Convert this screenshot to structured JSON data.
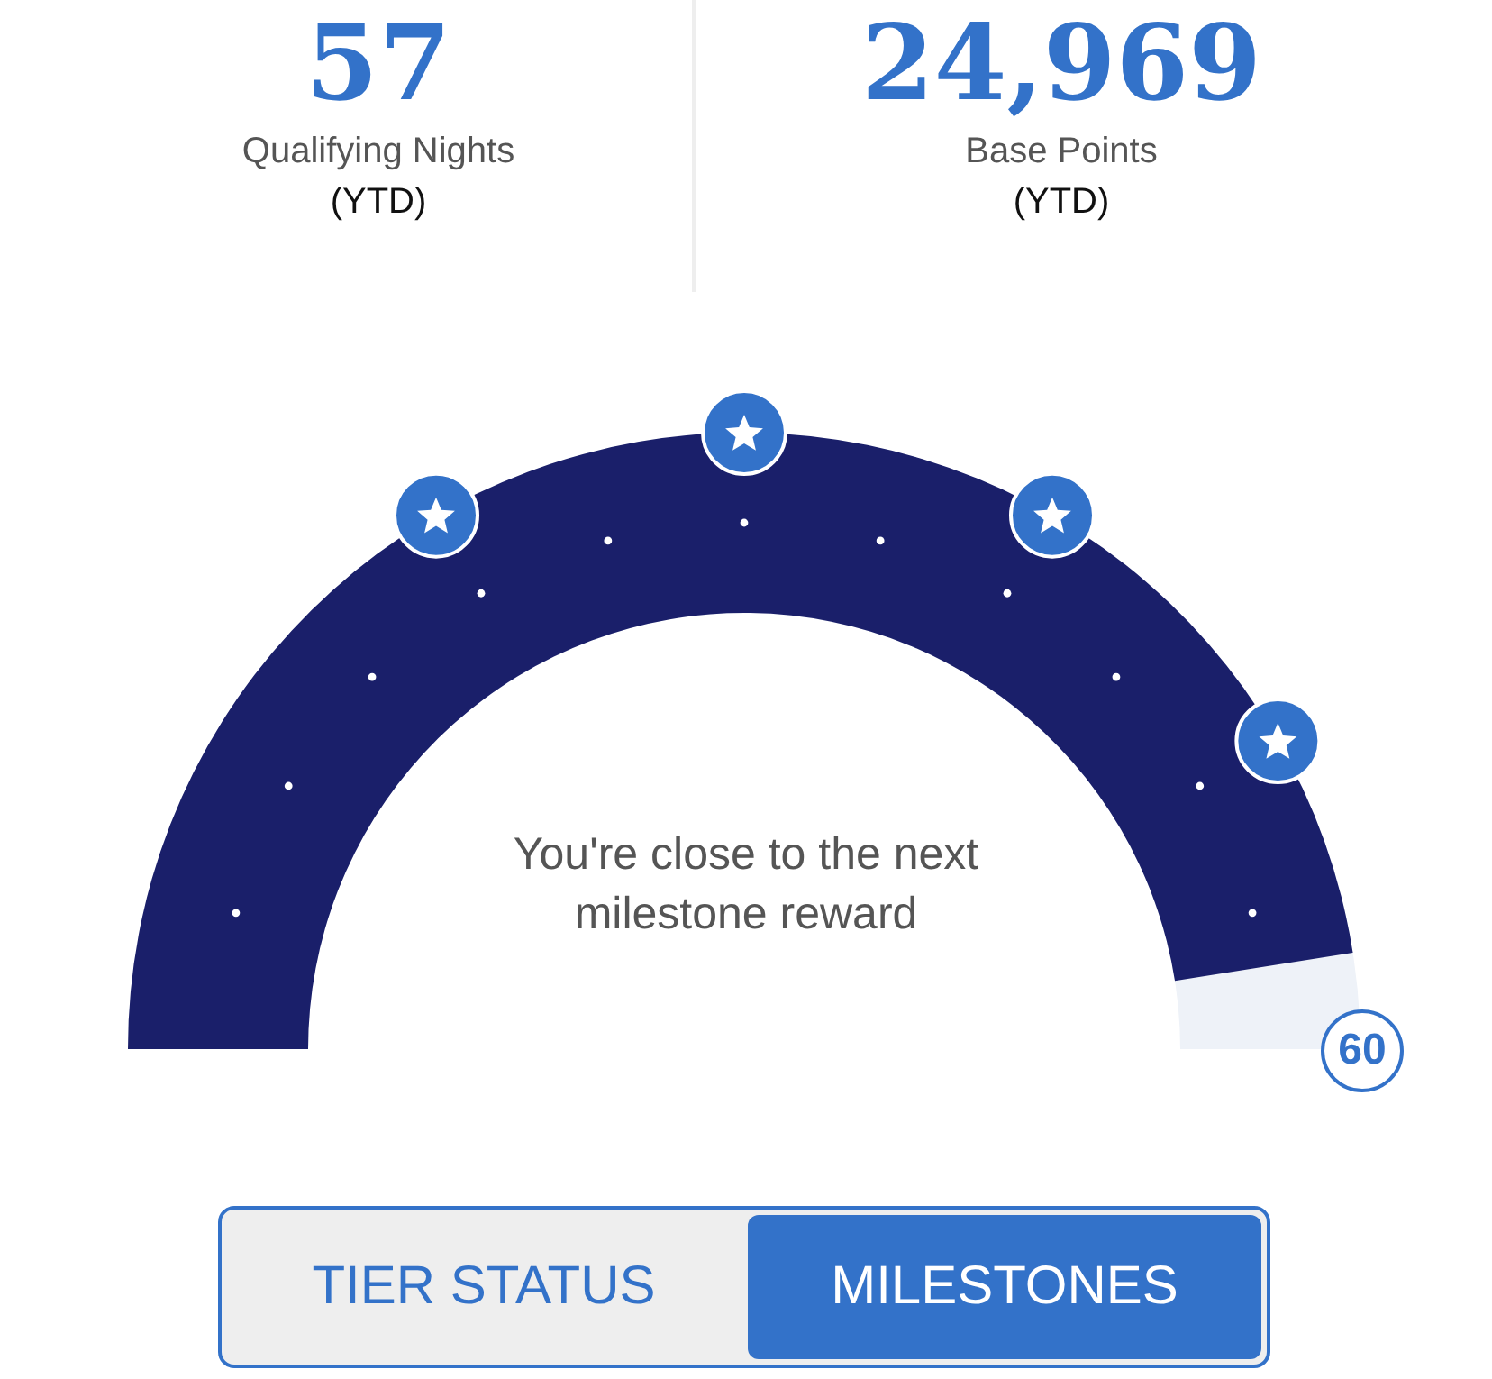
{
  "stats": [
    {
      "value": "57",
      "label": "Qualifying Nights",
      "period": "(YTD)"
    },
    {
      "value": "24,969",
      "label": "Base Points",
      "period": "(YTD)"
    }
  ],
  "gauge": {
    "level": 0.95,
    "message": "You're close to the next milestone reward",
    "goal": "60"
  },
  "toggle": [
    {
      "label": "TIER STATUS",
      "selected": false
    },
    {
      "label": "MILESTONES",
      "selected": true
    }
  ]
}
